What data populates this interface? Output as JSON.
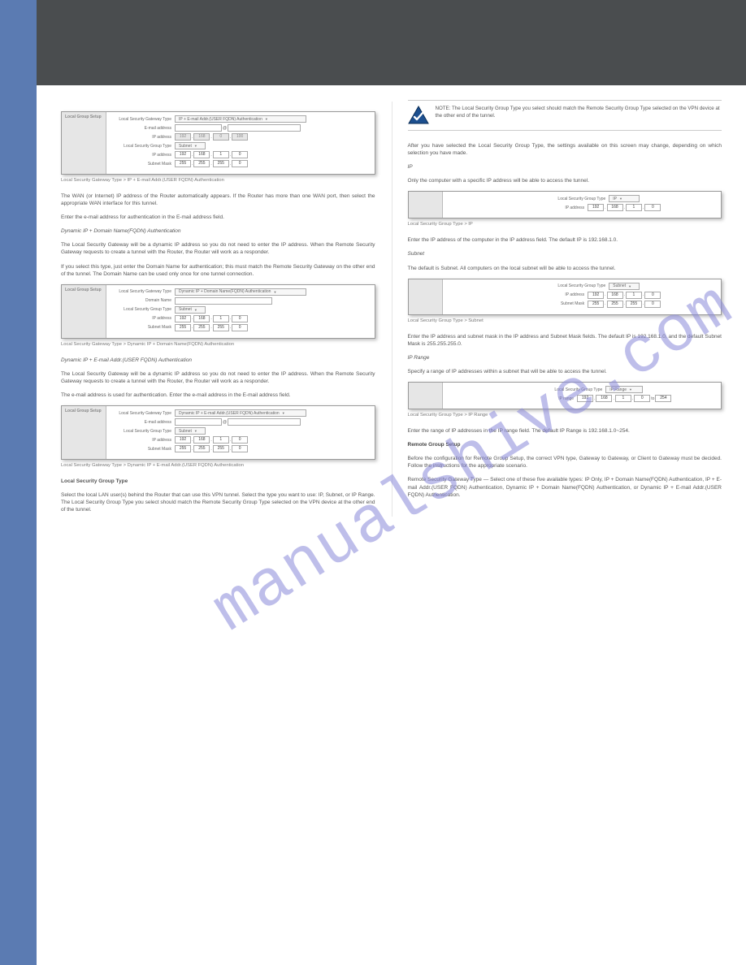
{
  "watermark": "manualshive.com",
  "left": {
    "panel1": {
      "side": "Local Group Setup",
      "gw_type_label": "Local Security Gateway Type",
      "gw_type_value": "IP + E-mail Addr.(USER FQDN) Authentication",
      "email_label": "E-mail address",
      "email_at": "@",
      "ip_label": "IP address",
      "ip1": "192",
      "ip2": "168",
      "ip3": "0",
      "ip4": "100",
      "grp_label": "Local Security Group Type",
      "grp_value": "Subnet",
      "grp_ip_label": "IP address",
      "g1": "192",
      "g2": "168",
      "g3": "1",
      "g4": "0",
      "mask_label": "Subnet Mask",
      "m1": "255",
      "m2": "255",
      "m3": "255",
      "m4": "0",
      "caption": "Local Security Gateway Type > IP + E-mail Addr.(USER FQDN) Authentication"
    },
    "text1": "The WAN (or Internet) IP address of the Router automatically appears. If the Router has more than one WAN port, then select the appropriate WAN interface for this tunnel.",
    "text2": "Enter the e-mail address for authentication in the E-mail address field.",
    "heading_dyn_domain": "Dynamic IP + Domain Name(FQDN) Authentication",
    "text3": "The Local Security Gateway will be a dynamic IP address so you do not need to enter the IP address. When the Remote Security Gateway requests to create a tunnel with the Router, the Router will work as a responder.",
    "text4": "If you select this type, just enter the Domain Name for authentication; this must match the Remote Security Gateway on the other end of the tunnel. The Domain Name can be used only once for one tunnel connection.",
    "panel2": {
      "side": "Local Group Setup",
      "gw_type_label": "Local Security Gateway Type",
      "gw_type_value": "Dynamic IP + Domain Name(FQDN) Authentication",
      "dn_label": "Domain Name",
      "grp_label": "Local Security Group Type",
      "grp_value": "Subnet",
      "grp_ip_label": "IP address",
      "g1": "192",
      "g2": "168",
      "g3": "1",
      "g4": "0",
      "mask_label": "Subnet Mask",
      "m1": "255",
      "m2": "255",
      "m3": "255",
      "m4": "0",
      "caption": "Local Security Gateway Type > Dynamic IP + Domain Name(FQDN) Authentication"
    },
    "heading_dyn_email": "Dynamic IP + E-mail Addr.(USER FQDN) Authentication",
    "text5": "The Local Security Gateway will be a dynamic IP address so you do not need to enter the IP address. When the Remote Security Gateway requests to create a tunnel with the Router, the Router will work as a responder.",
    "text6": "The e-mail address is used for authentication. Enter the e-mail address in the E-mail address field.",
    "panel3": {
      "side": "Local Group Setup",
      "gw_type_label": "Local Security Gateway Type",
      "gw_type_value": "Dynamic IP + E-mail Addr.(USER FQDN) Authentication",
      "email_label": "E-mail address",
      "grp_label": "Local Security Group Type",
      "grp_value": "Subnet",
      "grp_ip_label": "IP address",
      "g1": "192",
      "g2": "168",
      "g3": "1",
      "g4": "0",
      "mask_label": "Subnet Mask",
      "m1": "255",
      "m2": "255",
      "m3": "255",
      "m4": "0",
      "caption": "Local Security Gateway Type > Dynamic IP + E-mail Addr.(USER FQDN) Authentication"
    },
    "heading_lsg": "Local Security Group Type",
    "text7": "Select the local LAN user(s) behind the Router that can use this VPN tunnel. Select the type you want to use: IP, Subnet, or IP Range. The Local Security Group Type you select should match the Remote Security Group Type selected on the VPN device at the other end of the tunnel."
  },
  "right": {
    "note": "NOTE: The Local Security Group Type you select should match the Remote Security Group Type selected on the VPN device at the other end of the tunnel.",
    "text_intro": "After you have selected the Local Security Group Type, the settings available on this screen may change, depending on which selection you have made.",
    "ip_heading": "IP",
    "ip_text": "Only the computer with a specific IP address will be able to access the tunnel.",
    "panel_ip": {
      "grp_label": "Local Security Group Type",
      "grp_value": "IP",
      "ip_label": "IP address",
      "g1": "192",
      "g2": "168",
      "g3": "1",
      "g4": "0",
      "caption": "Local Security Group Type > IP"
    },
    "ip_text2": "Enter the IP address of the computer in the IP address field. The default IP is 192.168.1.0.",
    "subnet_heading": "Subnet",
    "subnet_text": "The default is Subnet. All computers on the local subnet will be able to access the tunnel.",
    "panel_subnet": {
      "grp_label": "Local Security Group Type",
      "grp_value": "Subnet",
      "ip_label": "IP address",
      "g1": "192",
      "g2": "168",
      "g3": "1",
      "g4": "0",
      "mask_label": "Subnet Mask",
      "m1": "255",
      "m2": "255",
      "m3": "255",
      "m4": "0",
      "caption": "Local Security Group Type > Subnet"
    },
    "subnet_text2": "Enter the IP address and subnet mask in the IP address and Subnet Mask fields. The default IP is 192.168.1.0, and the default Subnet Mask is 255.255.255.0.",
    "range_heading": "IP Range",
    "range_text": "Specify a range of IP addresses within a subnet that will be able to access the tunnel.",
    "panel_range": {
      "grp_label": "Local Security Group Type",
      "grp_value": "IP Range",
      "ip_label": "IP range",
      "g1": "192",
      "g2": "168",
      "g3": "1",
      "g4": "0",
      "to": "to",
      "g5": "254",
      "caption": "Local Security Group Type > IP Range"
    },
    "range_text2": "Enter the range of IP addresses in the IP range field. The default IP Range is 192.168.1.0~254.",
    "rgs_heading": "Remote Group Setup",
    "rgs_text1": "Before the configuration for Remote Group Setup, the correct VPN type, Gateway to Gateway, or Client to Gateway must be decided. Follow the instructions for the appropriate scenario.",
    "rgs_text2": "Remote Security Gateway Type — Select one of these five available types: IP Only, IP + Domain Name(FQDN) Authentication, IP + E-mail Addr.(USER FQDN) Authentication, Dynamic IP + Domain Name(FQDN) Authentication, or Dynamic IP + E-mail Addr.(USER FQDN) Authentication."
  }
}
